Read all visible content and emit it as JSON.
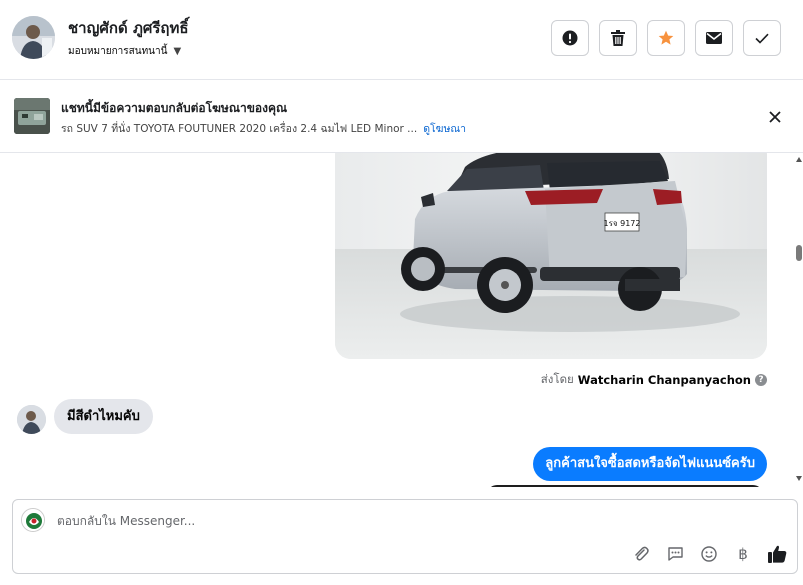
{
  "header": {
    "contact_name": "ชาญศักด์ ภูศรีฤทธิ์",
    "assign_label": "มอบหมายการสนทนานี้",
    "actions": [
      {
        "name": "mark-spam-button",
        "icon": "exclamation-icon"
      },
      {
        "name": "delete-button",
        "icon": "trash-icon"
      },
      {
        "name": "star-button",
        "icon": "star-icon",
        "color": "#f7923e"
      },
      {
        "name": "mark-unread-button",
        "icon": "envelope-icon"
      },
      {
        "name": "mark-done-button",
        "icon": "check-icon"
      }
    ]
  },
  "ad_bar": {
    "title": "แชทนี้มีข้อความตอบกลับต่อโฆษณาของคุณ",
    "subtitle": "รถ SUV 7 ที่นั่ง TOYOTA FOUTUNER 2020 เครื่อง 2.4 ฉมไฟ LED Minor ...",
    "link_label": "ดูโฆษณา"
  },
  "chat": {
    "sent_by_prefix": "ส่งโดย",
    "sent_by_name": "Watcharin Chanpanyachon",
    "help_glyph": "?",
    "license_plate": "1รจ 9172",
    "messages": [
      {
        "direction": "incoming",
        "text": "มีสีดำไหมคับ"
      },
      {
        "direction": "outgoing",
        "text": "ลูกค้าสนใจซื้อสดหรือจัดไฟแนนซ์ครับ"
      }
    ],
    "colors": {
      "outgoing_bubble": "#0a7cff",
      "incoming_bubble": "#e4e6eb"
    }
  },
  "composer": {
    "placeholder": "ตอบกลับใน Messenger...",
    "tools": [
      "paperclip-icon",
      "saved-replies-icon",
      "emoji-icon",
      "baht-icon",
      "thumbs-up-icon"
    ],
    "baht_glyph": "฿"
  }
}
